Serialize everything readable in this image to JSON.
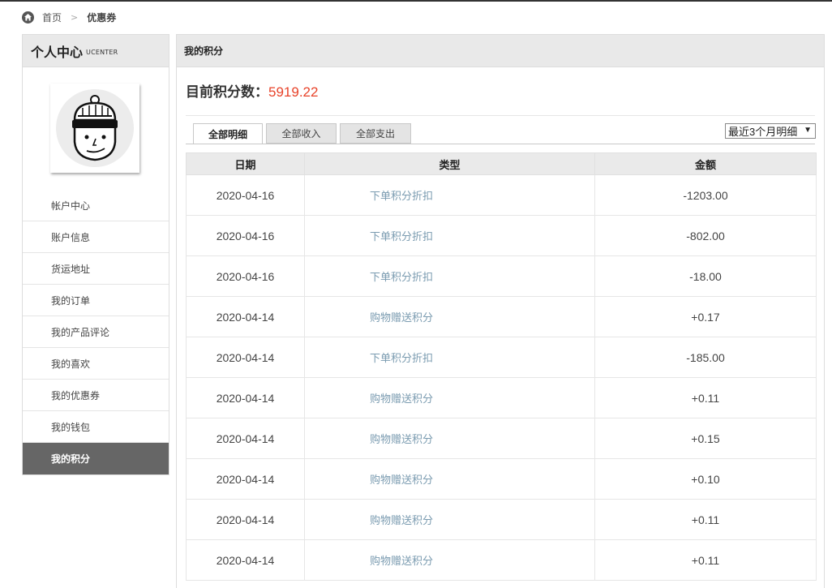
{
  "breadcrumb": {
    "home": "首页",
    "separator": ">",
    "current": "优惠券"
  },
  "sidebar": {
    "title": "个人中心",
    "subtitle": "UCENTER",
    "items": [
      {
        "label": "帐户中心",
        "active": false
      },
      {
        "label": "账户信息",
        "active": false
      },
      {
        "label": "货运地址",
        "active": false
      },
      {
        "label": "我的订单",
        "active": false
      },
      {
        "label": "我的产品评论",
        "active": false
      },
      {
        "label": "我的喜欢",
        "active": false
      },
      {
        "label": "我的优惠券",
        "active": false
      },
      {
        "label": "我的钱包",
        "active": false
      },
      {
        "label": "我的积分",
        "active": true
      }
    ]
  },
  "main": {
    "header": "我的积分",
    "points_label": "目前积分数：",
    "points_value": "5919.22",
    "tabs": [
      {
        "label": "全部明细",
        "active": true
      },
      {
        "label": "全部收入",
        "active": false
      },
      {
        "label": "全部支出",
        "active": false
      }
    ],
    "filter": {
      "selected": "最近3个月明细"
    },
    "table": {
      "columns": [
        "日期",
        "类型",
        "金额"
      ],
      "rows": [
        {
          "date": "2020-04-16",
          "type": "下单积分折扣",
          "amount": "-1203.00"
        },
        {
          "date": "2020-04-16",
          "type": "下单积分折扣",
          "amount": "-802.00"
        },
        {
          "date": "2020-04-16",
          "type": "下单积分折扣",
          "amount": "-18.00"
        },
        {
          "date": "2020-04-14",
          "type": "购物赠送积分",
          "amount": "+0.17"
        },
        {
          "date": "2020-04-14",
          "type": "下单积分折扣",
          "amount": "-185.00"
        },
        {
          "date": "2020-04-14",
          "type": "购物赠送积分",
          "amount": "+0.11"
        },
        {
          "date": "2020-04-14",
          "type": "购物赠送积分",
          "amount": "+0.15"
        },
        {
          "date": "2020-04-14",
          "type": "购物赠送积分",
          "amount": "+0.10"
        },
        {
          "date": "2020-04-14",
          "type": "购物赠送积分",
          "amount": "+0.11"
        },
        {
          "date": "2020-04-14",
          "type": "购物赠送积分",
          "amount": "+0.11"
        }
      ]
    }
  },
  "colors": {
    "points_value": "#e8432a",
    "type_link": "#7a9bb0",
    "active_menu_bg": "#666666",
    "header_bg": "#e9e9e9"
  },
  "icons": {
    "home": "home-icon",
    "avatar": "avatar-face-icon",
    "caret": "caret-down-icon"
  }
}
